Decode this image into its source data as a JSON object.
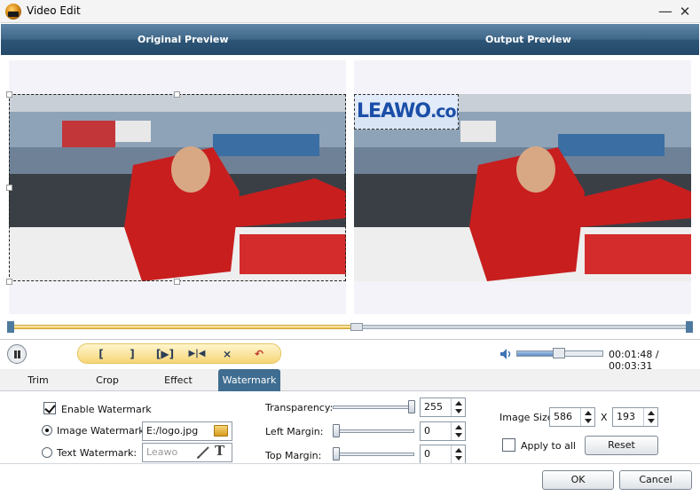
{
  "window": {
    "title": "Video Edit",
    "minimize_glyph": "—",
    "close_glyph": "✕"
  },
  "header": {
    "original_label": "Original Preview",
    "output_label": "Output Preview"
  },
  "watermark_preview": {
    "brand": "LEAWO",
    "suffix": ".com"
  },
  "timeline": {
    "progress": 0.51
  },
  "playback": {
    "volume": 0.5,
    "current_time": "00:01:48",
    "separator": "/",
    "total_time": "00:03:31",
    "tools": [
      {
        "name": "mark-in-icon",
        "glyph": "["
      },
      {
        "name": "mark-out-icon",
        "glyph": "]"
      },
      {
        "name": "play-segment-icon",
        "glyph": "[▶]"
      },
      {
        "name": "step-frame-icon",
        "glyph": "▶|◀"
      },
      {
        "name": "collapse-icon",
        "glyph": "⨯"
      },
      {
        "name": "undo-icon",
        "glyph": "↶"
      }
    ]
  },
  "tabs": [
    {
      "label": "Trim",
      "active": false
    },
    {
      "label": "Crop",
      "active": false
    },
    {
      "label": "Effect",
      "active": false
    },
    {
      "label": "Watermark",
      "active": true
    }
  ],
  "watermark": {
    "enable_label": "Enable Watermark",
    "enabled": true,
    "image_label": "Image Watermark:",
    "image_selected": true,
    "image_path": "E:/logo.jpg",
    "text_label": "Text Watermark:",
    "text_value": "Leawo",
    "transparency_label": "Transparency:",
    "transparency_value": "255",
    "transparency_level": 1.0,
    "left_margin_label": "Left Margin:",
    "left_margin_value": "0",
    "top_margin_label": "Top  Margin:",
    "top_margin_value": "0",
    "image_size_label": "Image Size:",
    "width_value": "586",
    "x_label": "X",
    "height_value": "193",
    "apply_all_label": "Apply to all",
    "apply_all": false,
    "reset_label": "Reset"
  },
  "footer": {
    "ok_label": "OK",
    "cancel_label": "Cancel"
  },
  "colors": {
    "accent": "#3f6d91",
    "header": "#2d5576",
    "highlight": "#f6d576"
  }
}
